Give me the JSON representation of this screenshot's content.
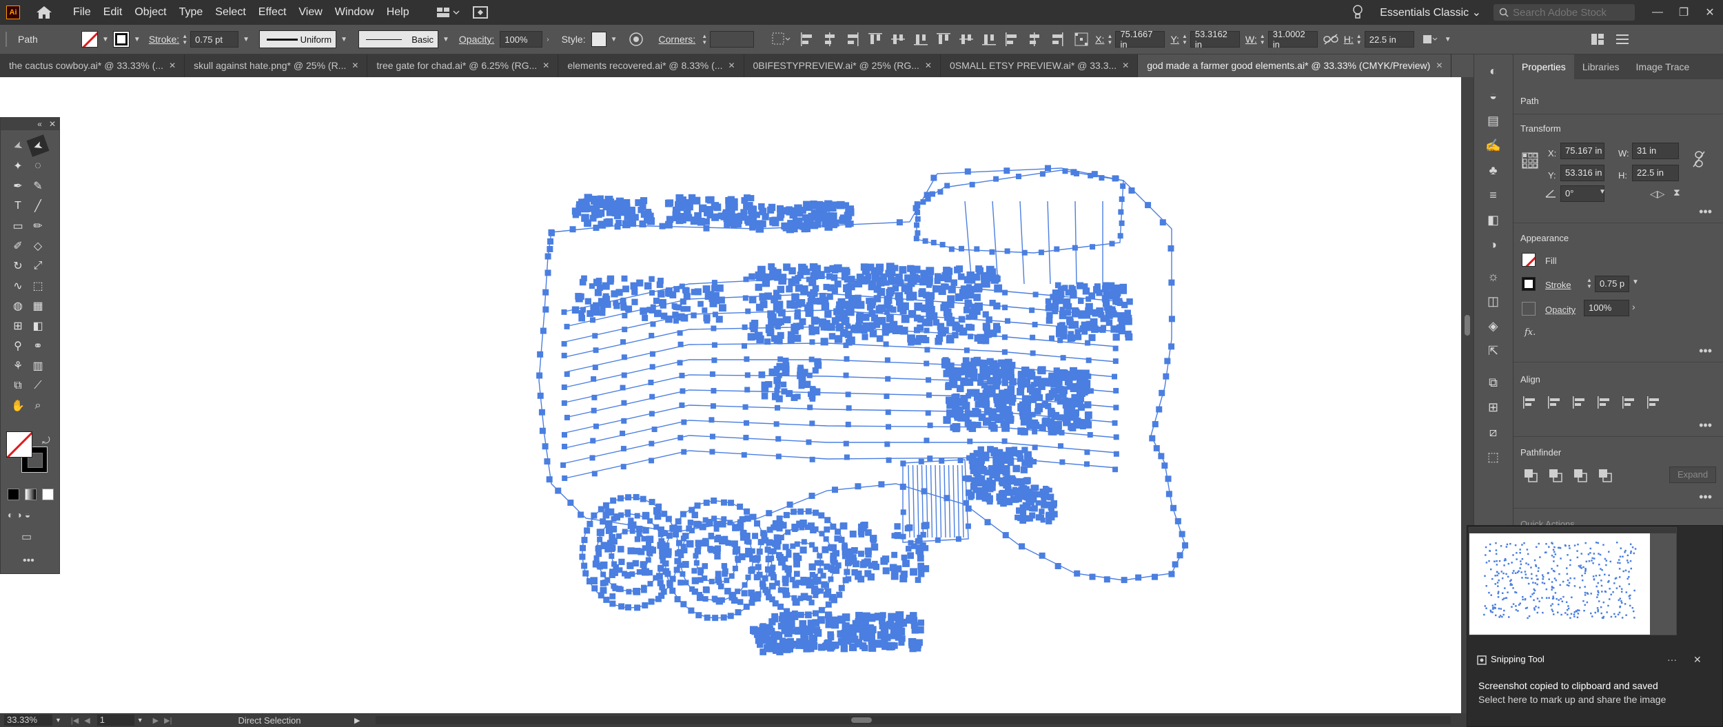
{
  "app": {
    "logo": "Ai",
    "menus": [
      "File",
      "Edit",
      "Object",
      "Type",
      "Select",
      "Effect",
      "View",
      "Window",
      "Help"
    ],
    "workspace": "Essentials Classic",
    "search_placeholder": "Search Adobe Stock"
  },
  "control_bar": {
    "selection_type": "Path",
    "stroke_label": "Stroke:",
    "stroke_weight": "0.75 pt",
    "profile": "Uniform",
    "brush": "Basic",
    "opacity_label": "Opacity:",
    "opacity": "100%",
    "style_label": "Style:",
    "corners_label": "Corners:",
    "x_label": "X:",
    "x": "75.1667 in",
    "y_label": "Y:",
    "y": "53.3162 in",
    "w_label": "W:",
    "w": "31.0002 in",
    "h_label": "H:",
    "h": "22.5 in"
  },
  "tabs": [
    {
      "label": "the cactus cowboy.ai* @ 33.33% (..."
    },
    {
      "label": "skull against hate.png* @ 25% (R..."
    },
    {
      "label": "tree gate for chad.ai* @ 6.25% (RG..."
    },
    {
      "label": "elements recovered.ai* @ 8.33% (..."
    },
    {
      "label": "0BIFESTYPREVIEW.ai* @ 25% (RG..."
    },
    {
      "label": "0SMALL ETSY PREVIEW.ai* @ 33.3..."
    },
    {
      "label": "god made a farmer good elements.ai* @ 33.33% (CMYK/Preview)"
    }
  ],
  "properties": {
    "tabs": [
      "Properties",
      "Libraries",
      "Image Trace"
    ],
    "object_type": "Path",
    "transform_title": "Transform",
    "x_label": "X:",
    "x": "75.167 in",
    "y_label": "Y:",
    "y": "53.316 in",
    "w_label": "W:",
    "w": "31 in",
    "h_label": "H:",
    "h": "22.5 in",
    "angle": "0°",
    "appearance_title": "Appearance",
    "fill_label": "Fill",
    "stroke_label": "Stroke",
    "stroke_value": "0.75 p",
    "opacity_label": "Opacity",
    "opacity": "100%",
    "fx_label": "fx.",
    "align_title": "Align",
    "pathfinder_title": "Pathfinder",
    "expand_label": "Expand",
    "quick_actions_title": "Quick Actions"
  },
  "notification": {
    "app": "Snipping Tool",
    "message": "Screenshot copied to clipboard and saved",
    "sub_message": "Select here to mark up and share the image",
    "more": "···",
    "close": "✕"
  },
  "status_bar": {
    "zoom": "33.33%",
    "page": "1",
    "tool": "Direct Selection"
  },
  "colors": {
    "path_selection": "#4a7ee0",
    "ui_dark": "#323232",
    "ui_panel": "#535353",
    "accent_logo": "#ff9a00"
  }
}
